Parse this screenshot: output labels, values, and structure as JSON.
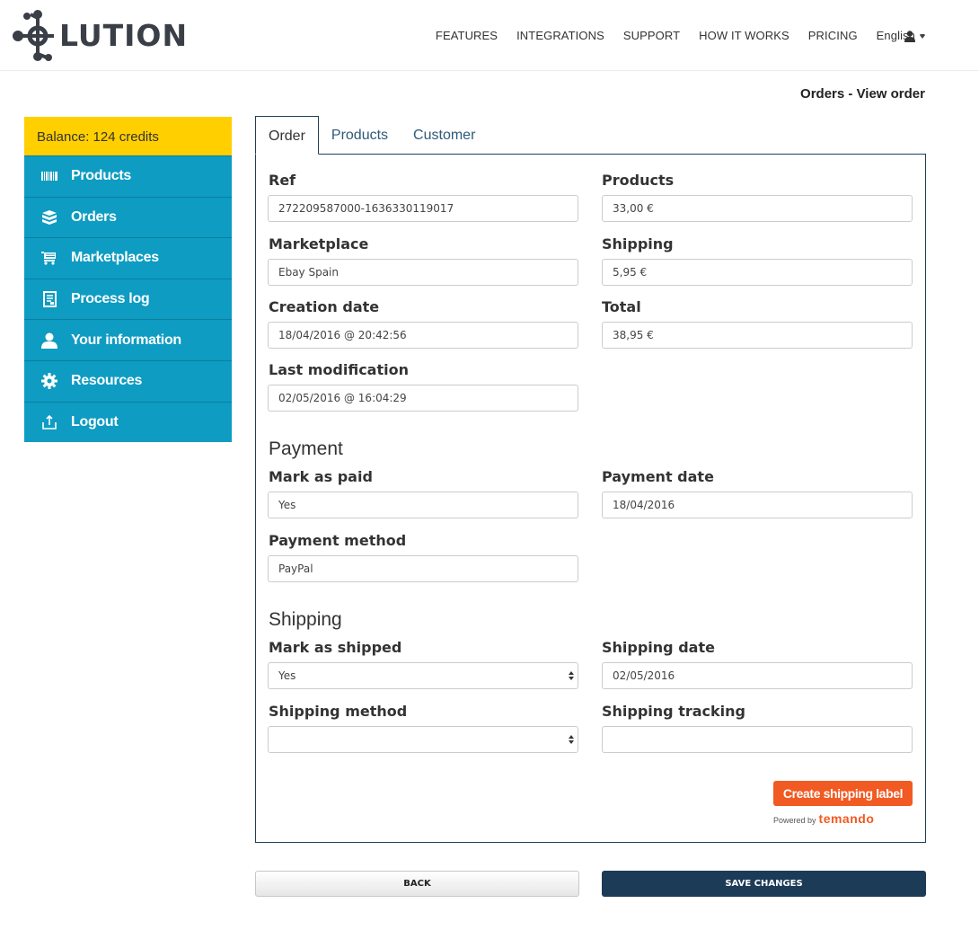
{
  "header": {
    "logo_text": "LUTION",
    "nav": [
      {
        "label": "FEATURES"
      },
      {
        "label": "INTEGRATIONS"
      },
      {
        "label": "SUPPORT"
      },
      {
        "label": "HOW IT WORKS"
      },
      {
        "label": "PRICING"
      }
    ],
    "language": "English",
    "user_icon": "user-icon"
  },
  "page_title": "Orders - View order",
  "sidebar": {
    "balance": "Balance: 124 credits",
    "items": [
      {
        "label": "Products",
        "icon": "barcode-icon"
      },
      {
        "label": "Orders",
        "icon": "boxes-icon"
      },
      {
        "label": "Marketplaces",
        "icon": "cart-icon"
      },
      {
        "label": "Process log",
        "icon": "log-icon"
      },
      {
        "label": "Your information",
        "icon": "user-icon"
      },
      {
        "label": "Resources",
        "icon": "gear-icon"
      },
      {
        "label": "Logout",
        "icon": "logout-icon"
      }
    ]
  },
  "tabs": [
    {
      "label": "Order",
      "active": true
    },
    {
      "label": "Products",
      "active": false
    },
    {
      "label": "Customer",
      "active": false
    }
  ],
  "order": {
    "ref_label": "Ref",
    "ref_value": "272209587000-1636330119017",
    "products_label": "Products",
    "products_value": "33,00 €",
    "marketplace_label": "Marketplace",
    "marketplace_value": "Ebay Spain",
    "shipping_label": "Shipping",
    "shipping_value": "5,95 €",
    "creation_label": "Creation date",
    "creation_value": "18/04/2016 @ 20:42:56",
    "total_label": "Total",
    "total_value": "38,95 €",
    "lastmod_label": "Last modification",
    "lastmod_value": "02/05/2016 @ 16:04:29"
  },
  "payment": {
    "title": "Payment",
    "paid_label": "Mark as paid",
    "paid_value": "Yes",
    "date_label": "Payment date",
    "date_value": "18/04/2016",
    "method_label": "Payment method",
    "method_value": "PayPal"
  },
  "shipping": {
    "title": "Shipping",
    "shipped_label": "Mark as shipped",
    "shipped_value": "Yes",
    "date_label": "Shipping date",
    "date_value": "02/05/2016",
    "method_label": "Shipping method",
    "method_value": "",
    "tracking_label": "Shipping tracking",
    "tracking_value": "",
    "label_button": "Create shipping label",
    "powered_by": "Powered by",
    "provider": "temando"
  },
  "actions": {
    "back": "BACK",
    "save": "SAVE CHANGES"
  },
  "colors": {
    "sidebar_bg": "#0e9cc2",
    "balance_bg": "#ffcf00",
    "save_bg": "#1c3b57",
    "label_button_bg": "#f15a22"
  }
}
